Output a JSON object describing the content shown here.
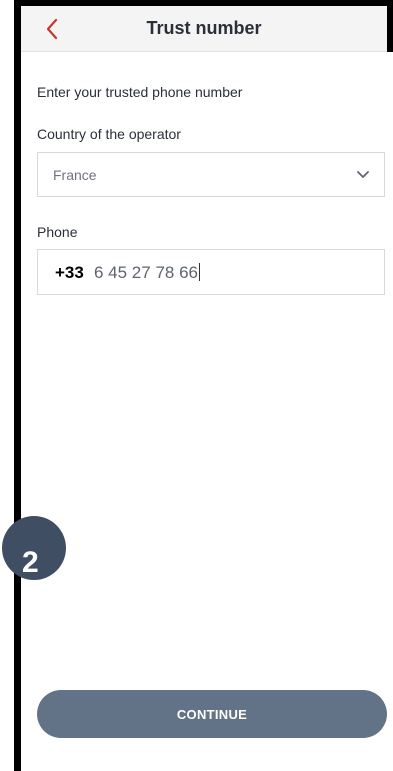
{
  "header": {
    "title": "Trust number",
    "back_icon": "chevron-left-icon"
  },
  "form": {
    "intro": "Enter your trusted phone number",
    "country_label": "Country of the operator",
    "country_value": "France",
    "phone_label": "Phone",
    "phone_prefix": "+33",
    "phone_number": "6 45 27 78 66"
  },
  "step_badge": "2",
  "continue_label": "CONTINUE",
  "colors": {
    "accent": "#c0392b",
    "button": "#627287",
    "badge": "#3f4e63"
  }
}
